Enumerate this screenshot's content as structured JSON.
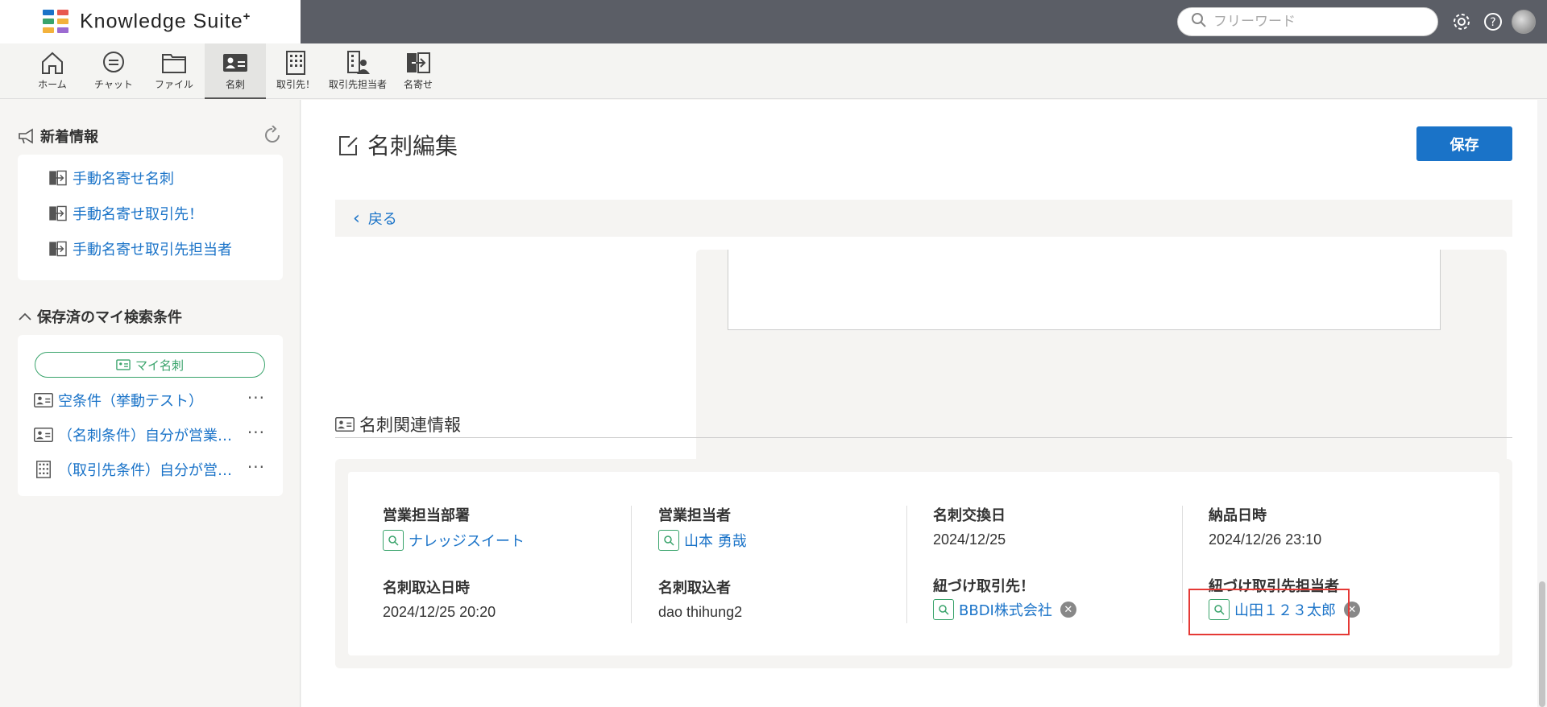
{
  "app": {
    "logo_text": "Knowledge Suite",
    "logo_plus": "+",
    "search_placeholder": "フリーワード",
    "colors": {
      "accent": "#1a73c8",
      "green": "#39a36b",
      "topbar": "#5b5e66",
      "highlight": "#e53935"
    }
  },
  "nav": {
    "items": [
      {
        "label": "ホーム",
        "icon": "home-icon"
      },
      {
        "label": "チャット",
        "icon": "chat-icon"
      },
      {
        "label": "ファイル",
        "icon": "folder-icon"
      },
      {
        "label": "名刺",
        "icon": "business-card-icon",
        "active": true
      },
      {
        "label": "取引先！",
        "icon": "building-icon"
      },
      {
        "label": "取引先担当者",
        "icon": "contact-person-icon"
      },
      {
        "label": "名寄せ",
        "icon": "merge-icon"
      }
    ]
  },
  "sidebar": {
    "news_title": "新着情報",
    "news_links": [
      "手動名寄せ名刺",
      "手動名寄せ取引先！",
      "手動名寄せ取引先担当者"
    ],
    "saved_title": "保存済のマイ検索条件",
    "my_card_pill": "マイ名刺",
    "saved_items": [
      {
        "label": "空条件（挙動テスト）",
        "icon": "business-card-icon"
      },
      {
        "label": "（名刺条件）自分が営業担当の名刺",
        "icon": "business-card-icon"
      },
      {
        "label": "（取引先条件）自分が営業担当の取引先",
        "icon": "building-icon"
      }
    ]
  },
  "main": {
    "page_title": "名刺編集",
    "save_label": "保存",
    "back_label": "戻る",
    "related_title": "名刺関連情報",
    "fields": {
      "sales_dept_label": "営業担当部署",
      "sales_dept_value": "ナレッジスイート",
      "import_datetime_label": "名刺取込日時",
      "import_datetime_value": "2024/12/25 20:20",
      "sales_person_label": "営業担当者",
      "sales_person_value": "山本 勇哉",
      "importer_label": "名刺取込者",
      "importer_value": "dao thihung2",
      "exchange_date_label": "名刺交換日",
      "exchange_date_value": "2024/12/25",
      "linked_account_label": "紐づけ取引先！",
      "linked_account_value": "BBDI株式会社",
      "delivery_datetime_label": "納品日時",
      "delivery_datetime_value": "2024/12/26 23:10",
      "linked_contact_label": "紐づけ取引先担当者",
      "linked_contact_value": "山田１２３太郎"
    }
  }
}
